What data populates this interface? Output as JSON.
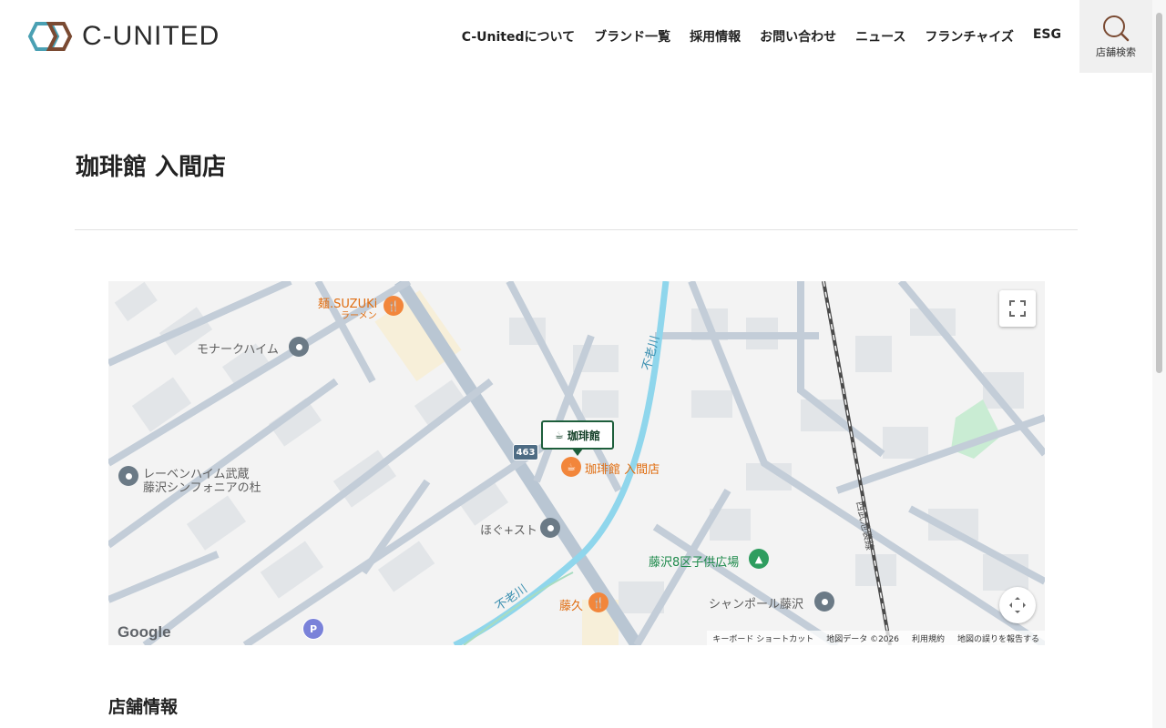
{
  "header": {
    "logo_text": "C-UNITED",
    "nav": [
      "C-Unitedについて",
      "ブランド一覧",
      "採用情報",
      "お問い合わせ",
      "ニュース",
      "フランチャイズ",
      "ESG"
    ],
    "store_search_label": "店舗検索"
  },
  "page": {
    "title": "珈琲館 入間店",
    "section_title": "店舗情報"
  },
  "map": {
    "labels": {
      "suzuki": "麺.SUZUKi",
      "suzuki_sub": "ラーメン",
      "monarch": "モナークハイム",
      "leben_1": "レーベンハイム武蔵",
      "leben_2": "藤沢シンフォニアの杜",
      "store": "珈琲館 入間店",
      "marker_brand": "珈琲館",
      "hogu": "ほぐ+スト",
      "park": "藤沢8区子供広場",
      "fujihisa": "藤久",
      "champole": "シャンポール藤沢",
      "river_1": "不老川",
      "river_2": "不老川",
      "railway": "西武池袋線",
      "route": "463",
      "parking": "P"
    },
    "google": "Google",
    "attribution": [
      "キーボード ショートカット",
      "地図データ ©2026",
      "利用規約",
      "地図の誤りを報告する"
    ],
    "icons": {
      "fullscreen": "fullscreen-icon",
      "camera": "camera-control-icon",
      "restaurant": "fork-knife-icon",
      "cafe": "coffee-icon",
      "park": "tree-icon",
      "place": "pin-icon"
    }
  },
  "colors": {
    "river": "#8fd6ec",
    "road": "#b9c6d3",
    "block": "#dfe2e5",
    "accent_green": "#1d5e3b",
    "poi_orange": "#e06d10"
  }
}
